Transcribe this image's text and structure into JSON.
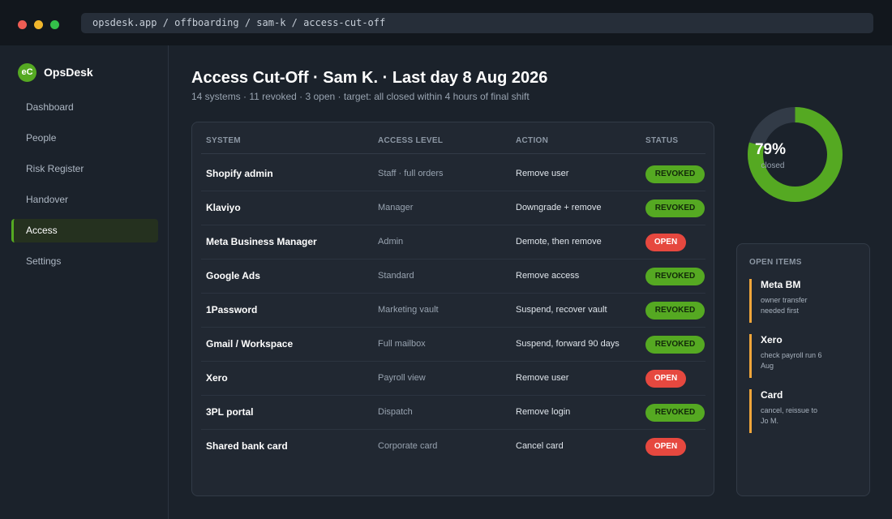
{
  "window": {
    "url": "opsdesk.app / offboarding / sam-k / access-cut-off"
  },
  "sidebar": {
    "logo_text": "eC",
    "brand": "OpsDesk",
    "items": [
      {
        "label": "Dashboard",
        "active": false
      },
      {
        "label": "People",
        "active": false
      },
      {
        "label": "Risk Register",
        "active": false
      },
      {
        "label": "Handover",
        "active": false
      },
      {
        "label": "Access",
        "active": true
      },
      {
        "label": "Settings",
        "active": false
      }
    ]
  },
  "header": {
    "title": "Access Cut-Off  ·  Sam K.  ·  Last day 8 Aug 2026",
    "subtitle": "14 systems  ·  11 revoked  ·  3 open  ·  target: all closed within 4 hours of final shift"
  },
  "table": {
    "columns": [
      "SYSTEM",
      "ACCESS LEVEL",
      "ACTION",
      "STATUS"
    ],
    "rows": [
      {
        "system": "Shopify admin",
        "level": "Staff · full orders",
        "action": "Remove user",
        "status": "REVOKED"
      },
      {
        "system": "Klaviyo",
        "level": "Manager",
        "action": "Downgrade + remove",
        "status": "REVOKED"
      },
      {
        "system": "Meta Business Manager",
        "level": "Admin",
        "action": "Demote, then remove",
        "status": "OPEN"
      },
      {
        "system": "Google Ads",
        "level": "Standard",
        "action": "Remove access",
        "status": "REVOKED"
      },
      {
        "system": "1Password",
        "level": "Marketing vault",
        "action": "Suspend, recover vault",
        "status": "REVOKED"
      },
      {
        "system": "Gmail / Workspace",
        "level": "Full mailbox",
        "action": "Suspend, forward 90 days",
        "status": "REVOKED"
      },
      {
        "system": "Xero",
        "level": "Payroll view",
        "action": "Remove user",
        "status": "OPEN"
      },
      {
        "system": "3PL portal",
        "level": "Dispatch",
        "action": "Remove login",
        "status": "REVOKED"
      },
      {
        "system": "Shared bank card",
        "level": "Corporate card",
        "action": "Cancel card",
        "status": "OPEN"
      }
    ]
  },
  "progress": {
    "percent_label": "79%",
    "caption": "closed",
    "fraction": 0.79,
    "fill_color": "#55a922",
    "track_color": "#323b47"
  },
  "open_items": {
    "heading": "OPEN ITEMS",
    "items": [
      {
        "title": "Meta BM",
        "note": "owner transfer needed first"
      },
      {
        "title": "Xero",
        "note": "check payroll run 6 Aug"
      },
      {
        "title": "Card",
        "note": "cancel, reissue to Jo M."
      }
    ]
  },
  "colors": {
    "accent": "#55a922",
    "revoked": "#55a922",
    "open": "#e6483f",
    "pending_marker": "#f0a63a"
  }
}
